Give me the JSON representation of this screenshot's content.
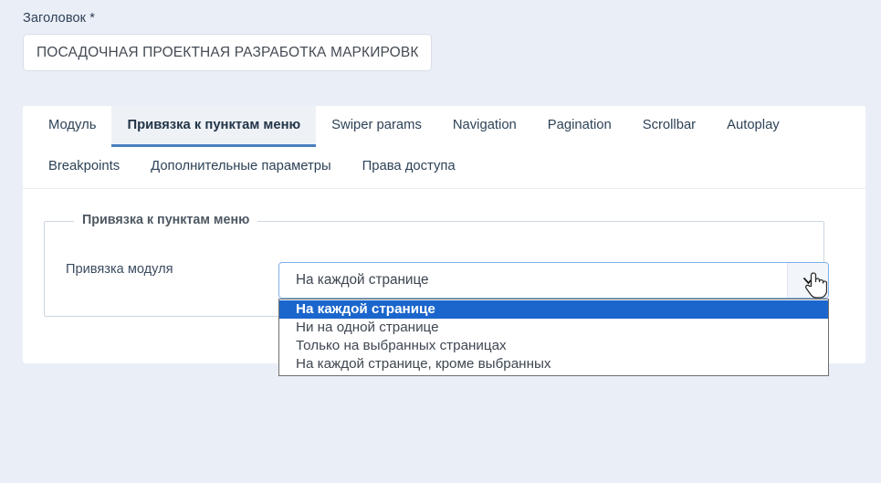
{
  "form": {
    "title_label": "Заголовок *",
    "title_value": "ПОСАДОЧНАЯ ПРОЕКТНАЯ РАЗРАБОТКА МАРКИРОВК",
    "title_placeholder": "Заголовок"
  },
  "tabs": [
    {
      "label": "Модуль",
      "active": false
    },
    {
      "label": "Привязка к пунктам меню",
      "active": true
    },
    {
      "label": "Swiper params",
      "active": false
    },
    {
      "label": "Navigation",
      "active": false
    },
    {
      "label": "Pagination",
      "active": false
    },
    {
      "label": "Scrollbar",
      "active": false
    },
    {
      "label": "Autoplay",
      "active": false
    },
    {
      "label": "Breakpoints",
      "active": false
    },
    {
      "label": "Дополнительные параметры",
      "active": false
    },
    {
      "label": "Права доступа",
      "active": false
    }
  ],
  "fieldset": {
    "legend": "Привязка к пунктам меню",
    "row_label": "Привязка модуля"
  },
  "select": {
    "value": "На каждой странице",
    "arrow_icon": "chevron-down-icon",
    "options": [
      {
        "label": "На каждой странице",
        "selected": true
      },
      {
        "label": "Ни на одной странице",
        "selected": false
      },
      {
        "label": "Только на выбранных страницах",
        "selected": false
      },
      {
        "label": "На каждой странице, кроме выбранных",
        "selected": false
      }
    ]
  },
  "cursor": {
    "icon": "pointer-hand-cursor"
  },
  "colors": {
    "page_background": "#eaeff7",
    "panel_background": "#ffffff",
    "accent_blue": "#1b66cc",
    "tab_active_underline": "#4a7fc1",
    "tab_active_background": "#eef2f7",
    "select_border_focus": "#7cb0e6",
    "text_primary": "#2d4257"
  }
}
